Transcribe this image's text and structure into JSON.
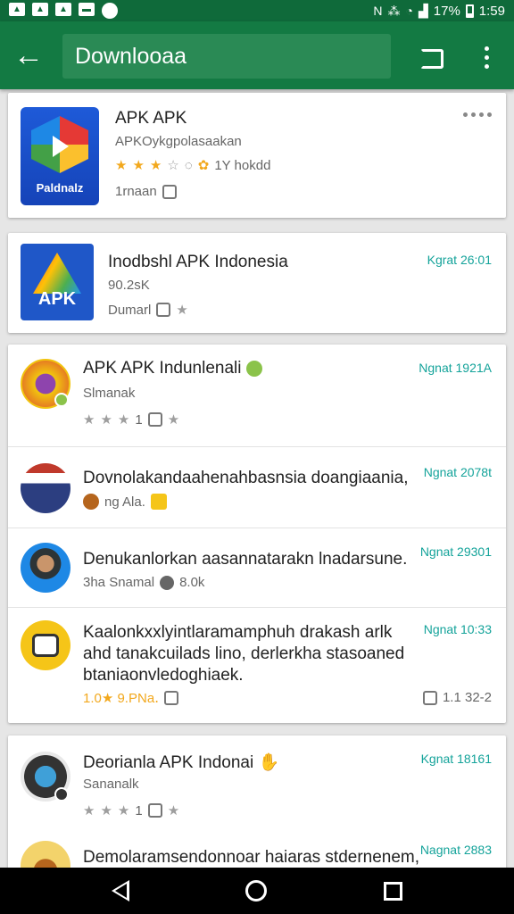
{
  "status_bar": {
    "battery": "17%",
    "time": "1:59"
  },
  "app_bar": {
    "search_value": "Downlooaa"
  },
  "card1": {
    "title": "APK APK",
    "subtitle": "APKOykgpolasaakan",
    "rating_text": "1Y hokdd",
    "meta": "1rnaan",
    "rating_stars": 3
  },
  "card2": {
    "title": "Inodbshl APK Indonesia",
    "size": "90.2sK",
    "meta": "Dumarl",
    "date": "Kgrat 26:01",
    "icon_label": "APK"
  },
  "card1_icon_label": "Paldnalz",
  "list": [
    {
      "title": "APK APK Indunlenali",
      "sub": "Slmanak",
      "meta": "1",
      "date": "Ngnat 1921A"
    },
    {
      "title": "Dovnolakandaahenahbasnsia doangiaania,",
      "meta": "ng Ala.",
      "date": "Ngnat 2078t"
    },
    {
      "title": "Denukanlorkan aasannatarakn lnadarsune.",
      "meta": "3ha Snamal",
      "meta2": "8.0k",
      "date": "Ngnat 29301"
    },
    {
      "lines": [
        "Kaalonkxxlyintlaramamphuh drakash arlk",
        "ahd tanakcuilads lino, derlerkha stasoaned",
        "btaniaonvledoghiaek."
      ],
      "meta": "1.0★ 9.PNa․",
      "date": "Ngnat 10:33",
      "meta_right": "1.1 32-2"
    }
  ],
  "card4": [
    {
      "title": "Deorianla APK Indonai",
      "sub": "Sananalk",
      "meta": "1",
      "date": "Kgnat 18161"
    },
    {
      "title": "Demolaramsendonnoar haiaras stdernenem,",
      "date": "Nagnat 2883"
    }
  ]
}
